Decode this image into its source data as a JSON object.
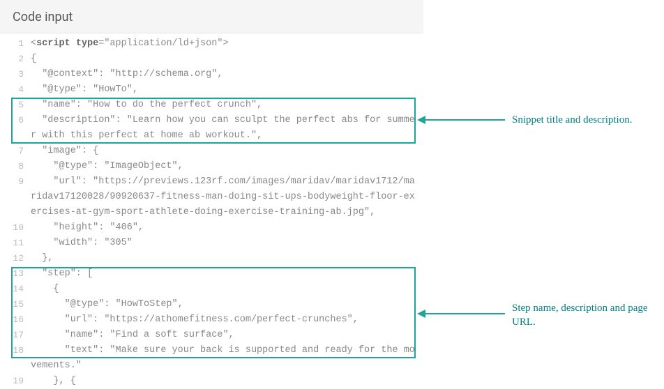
{
  "panel": {
    "title": "Code input"
  },
  "code": {
    "lines": [
      {
        "n": "1",
        "html": "&lt;<b>script type</b>=\"application/ld+json\"&gt;"
      },
      {
        "n": "2",
        "html": "{"
      },
      {
        "n": "3",
        "html": "  \"@context\": \"http://schema.org\","
      },
      {
        "n": "4",
        "html": "  \"@type\": \"HowTo\","
      },
      {
        "n": "5",
        "html": "  \"name\": \"How to do the perfect crunch\","
      },
      {
        "n": "6",
        "html": "  \"description\": \"Learn how you can sculpt the perfect abs for summer with this perfect at home ab workout.\","
      },
      {
        "n": "7",
        "html": "  \"image\": {"
      },
      {
        "n": "8",
        "html": "    \"@type\": \"ImageObject\","
      },
      {
        "n": "9",
        "html": "    \"url\": \"https://previews.123rf.com/images/maridav/maridav1712/maridav17120028/90920637-fitness-man-doing-sit-ups-bodyweight-floor-exercises-at-gym-sport-athlete-doing-exercise-training-ab.jpg\","
      },
      {
        "n": "10",
        "html": "    \"height\": \"406\","
      },
      {
        "n": "11",
        "html": "    \"width\": \"305\""
      },
      {
        "n": "12",
        "html": "  },"
      },
      {
        "n": "13",
        "html": "  \"step\": ["
      },
      {
        "n": "14",
        "html": "    {"
      },
      {
        "n": "15",
        "html": "      \"@type\": \"HowToStep\","
      },
      {
        "n": "16",
        "html": "      \"url\": \"https://athomefitness.com/perfect-crunches\","
      },
      {
        "n": "17",
        "html": "      \"name\": \"Find a soft surface\","
      },
      {
        "n": "18",
        "html": "      \"text\": \"Make sure your back is supported and ready for the movements.\""
      },
      {
        "n": "19",
        "html": "    }, {"
      }
    ]
  },
  "annotations": {
    "a1": "Snippet title and description.",
    "a2": "Step name, description and page URL."
  }
}
